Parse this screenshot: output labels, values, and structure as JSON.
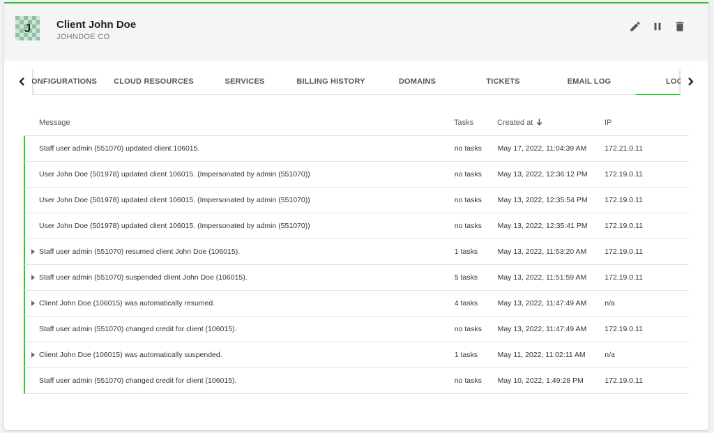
{
  "client": {
    "avatar_initial": "J",
    "name": "Client John Doe",
    "company": "JOHNDOE CO"
  },
  "actions": {
    "edit_icon": "pencil-icon",
    "suspend_icon": "pause-icon",
    "delete_icon": "trash-icon"
  },
  "tabs": [
    {
      "label": "CONFIGURATIONS"
    },
    {
      "label": "CLOUD RESOURCES"
    },
    {
      "label": "SERVICES"
    },
    {
      "label": "BILLING HISTORY"
    },
    {
      "label": "DOMAINS"
    },
    {
      "label": "TICKETS"
    },
    {
      "label": "EMAIL LOG"
    },
    {
      "label": "LOGS",
      "active": true
    }
  ],
  "table": {
    "headers": {
      "message": "Message",
      "tasks": "Tasks",
      "created": "Created at",
      "ip": "IP"
    },
    "rows": [
      {
        "message": "Staff user admin (551070) updated client 106015.",
        "tasks": "no tasks",
        "created": "May 17, 2022, 11:04:39 AM",
        "ip": "172.21.0.11",
        "expandable": false
      },
      {
        "message": "User John Doe (501978) updated client 106015. (Impersonated by admin (551070))",
        "tasks": "no tasks",
        "created": "May 13, 2022, 12:36:12 PM",
        "ip": "172.19.0.11",
        "expandable": false
      },
      {
        "message": "User John Doe (501978) updated client 106015. (Impersonated by admin (551070))",
        "tasks": "no tasks",
        "created": "May 13, 2022, 12:35:54 PM",
        "ip": "172.19.0.11",
        "expandable": false
      },
      {
        "message": "User John Doe (501978) updated client 106015. (Impersonated by admin (551070))",
        "tasks": "no tasks",
        "created": "May 13, 2022, 12:35:41 PM",
        "ip": "172.19.0.11",
        "expandable": false
      },
      {
        "message": "Staff user admin (551070) resumed client John Doe (106015).",
        "tasks": "1 tasks",
        "created": "May 13, 2022, 11:53:20 AM",
        "ip": "172.19.0.11",
        "expandable": true
      },
      {
        "message": "Staff user admin (551070) suspended client John Doe (106015).",
        "tasks": "5 tasks",
        "created": "May 13, 2022, 11:51:59 AM",
        "ip": "172.19.0.11",
        "expandable": true
      },
      {
        "message": "Client John Doe (106015) was automatically resumed.",
        "tasks": "4 tasks",
        "created": "May 13, 2022, 11:47:49 AM",
        "ip": "n/a",
        "expandable": true
      },
      {
        "message": "Staff user admin (551070) changed credit for client (106015).",
        "tasks": "no tasks",
        "created": "May 13, 2022, 11:47:49 AM",
        "ip": "172.19.0.11",
        "expandable": false
      },
      {
        "message": "Client John Doe (106015) was automatically suspended.",
        "tasks": "1 tasks",
        "created": "May 11, 2022, 11:02:11 AM",
        "ip": "n/a",
        "expandable": true
      },
      {
        "message": "Staff user admin (551070) changed credit for client (106015).",
        "tasks": "no tasks",
        "created": "May 10, 2022, 1:49:28 PM",
        "ip": "172.19.0.11",
        "expandable": false
      }
    ]
  },
  "colors": {
    "accent": "#4caf50",
    "header_bg": "#f5f5f5"
  }
}
